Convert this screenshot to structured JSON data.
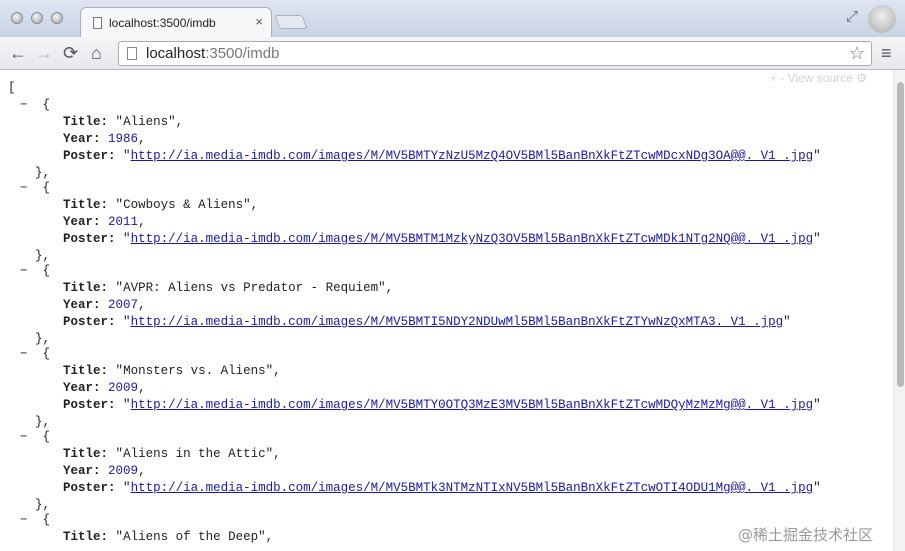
{
  "browser": {
    "tab_title": "localhost:3500/imdb",
    "tab_close": "×",
    "url_host": "localhost",
    "url_rest": ":3500/imdb",
    "back_glyph": "←",
    "forward_glyph": "→",
    "reload_glyph": "⟳",
    "home_glyph": "⌂",
    "star_glyph": "☆",
    "menu_glyph": "≡",
    "resize_glyph": "⤢"
  },
  "viewer": {
    "view_source_label": "+  -  View source  ⚙"
  },
  "json": {
    "open_bracket": "[",
    "collapse_glyph": "−",
    "open_brace": "{",
    "close_brace": "},",
    "title_key": "Title",
    "year_key": "Year",
    "poster_key": "Poster",
    "movies": [
      {
        "title": "Aliens",
        "year": "1986",
        "poster": "http://ia.media-imdb.com/images/M/MV5BMTYzNzU5MzQ4OV5BMl5BanBnXkFtZTcwMDcxNDg3OA@@._V1_.jpg"
      },
      {
        "title": "Cowboys & Aliens",
        "year": "2011",
        "poster": "http://ia.media-imdb.com/images/M/MV5BMTM1MzkyNzQ3OV5BMl5BanBnXkFtZTcwMDk1NTg2NQ@@._V1_.jpg"
      },
      {
        "title": "AVPR: Aliens vs Predator - Requiem",
        "year": "2007",
        "poster": "http://ia.media-imdb.com/images/M/MV5BMTI5NDY2NDUwMl5BMl5BanBnXkFtZTYwNzQxMTA3._V1_.jpg"
      },
      {
        "title": "Monsters vs. Aliens",
        "year": "2009",
        "poster": "http://ia.media-imdb.com/images/M/MV5BMTY0OTQ3MzE3MV5BMl5BanBnXkFtZTcwMDQyMzMzMg@@._V1_.jpg"
      },
      {
        "title": "Aliens in the Attic",
        "year": "2009",
        "poster": "http://ia.media-imdb.com/images/M/MV5BMTk3NTMzNTIxNV5BMl5BanBnXkFtZTcwOTI4ODU1Mg@@._V1_.jpg"
      },
      {
        "title": "Aliens of the Deep",
        "year": "",
        "poster": ""
      }
    ]
  },
  "watermark": "@稀土掘金技术社区"
}
